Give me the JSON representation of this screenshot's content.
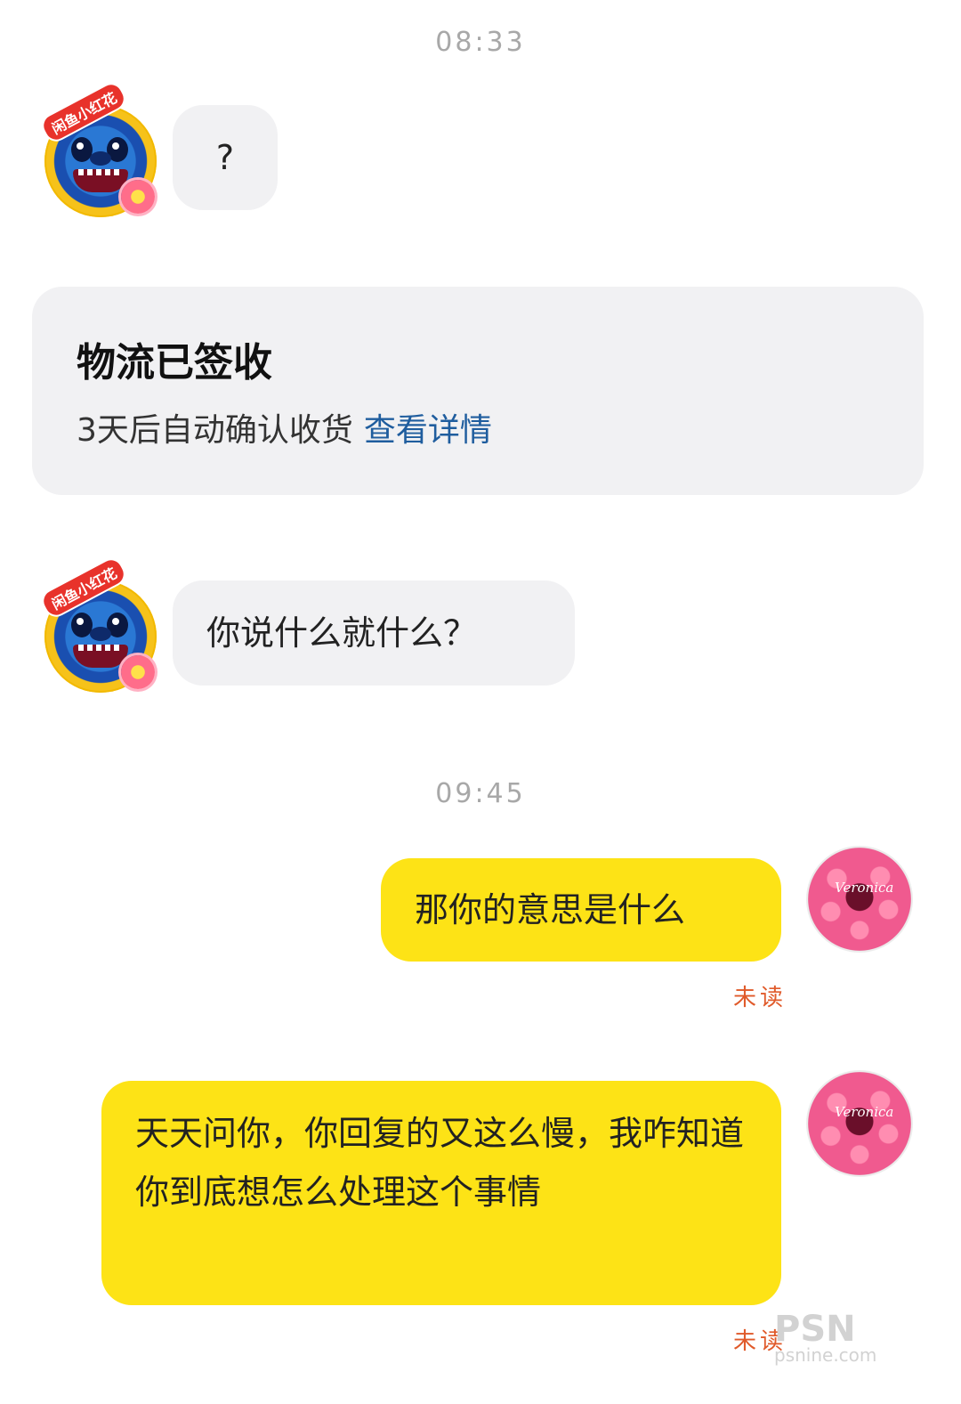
{
  "timestamps": [
    "08:33",
    "09:45"
  ],
  "messages": {
    "m1": "?",
    "m2": "你说什么就什么？",
    "m3": "那你的意思是什么",
    "m4": "天天问你，你回复的又这么慢，我咋知道你到底想怎么处理这个事情"
  },
  "logistics_card": {
    "title": "物流已签收",
    "subtitle": "3天后自动确认收货",
    "link": "查看详情"
  },
  "status": {
    "unread1": "未读",
    "unread2": "未读"
  },
  "avatars": {
    "seller_badge": "闲鱼小红花",
    "self_signature": "Veronica"
  },
  "watermark": {
    "brand": "PSN",
    "site": "psnine.com"
  },
  "colors": {
    "incoming_bubble": "#f1f1f3",
    "outgoing_bubble": "#fde316",
    "link": "#1f5d9e",
    "unread": "#e05a2a"
  }
}
